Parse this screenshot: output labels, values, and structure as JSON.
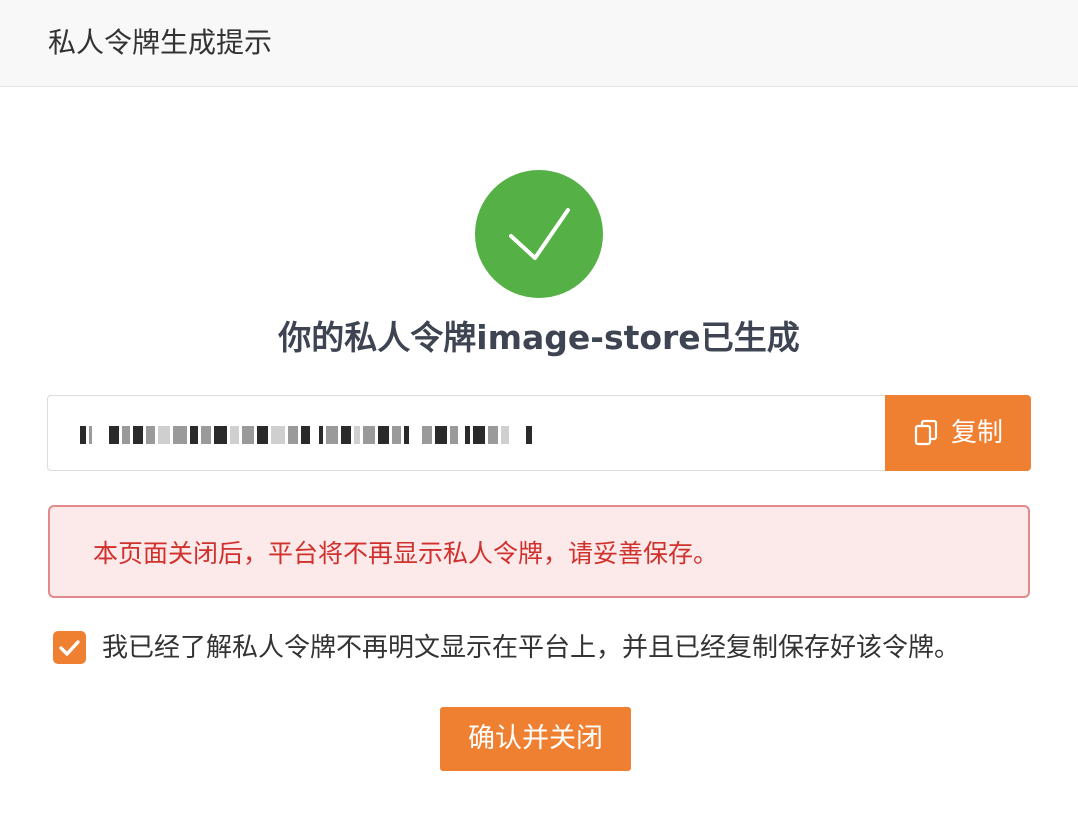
{
  "dialog": {
    "title": "私人令牌生成提示"
  },
  "status": {
    "heading": "你的私人令牌image-store已生成",
    "icon": "check-circle-icon",
    "color": "#55b046"
  },
  "token": {
    "masked": true,
    "copy_icon": "copy-icon",
    "copy_label": "复制"
  },
  "alert": {
    "text": "本页面关闭后，平台将不再显示私人令牌，请妥善保存。",
    "color": "#d0312d",
    "background": "#fce9e9"
  },
  "acknowledge": {
    "checked": true,
    "label": "我已经了解私人令牌不再明文显示在平台上，并且已经复制保存好该令牌。"
  },
  "actions": {
    "confirm_label": "确认并关闭",
    "accent": "#ef7f31"
  }
}
